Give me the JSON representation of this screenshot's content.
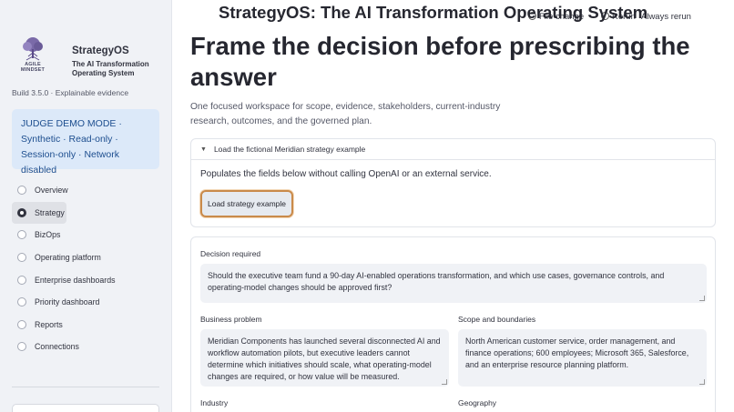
{
  "overlay_title": "StrategyOS: The AI Transformation Operating System",
  "toolbar": {
    "items": [
      "File change",
      "Rerun",
      "Always rerun"
    ]
  },
  "sidebar": {
    "logo_text_line1": "AGILE",
    "logo_text_line2": "MINDSET",
    "brand_name": "StrategyOS",
    "brand_sub": "The AI Transformation Operating System",
    "build": "Build 3.5.0 · Explainable evidence",
    "demo_notice": "JUDGE DEMO MODE · Synthetic · Read-only · Session-only · Network disabled",
    "nav": [
      {
        "label": "Overview",
        "active": false
      },
      {
        "label": "Strategy",
        "active": true
      },
      {
        "label": "BizOps",
        "active": false
      },
      {
        "label": "Operating platform",
        "active": false
      },
      {
        "label": "Enterprise dashboards",
        "active": false
      },
      {
        "label": "Priority dashboard",
        "active": false
      },
      {
        "label": "Reports",
        "active": false
      },
      {
        "label": "Connections",
        "active": false
      }
    ]
  },
  "main": {
    "heading": "Frame the decision before prescribing the answer",
    "lead": "One focused workspace for scope, evidence, stakeholders, current-industry research, outcomes, and the governed plan.",
    "expander": {
      "title": "Load the fictional Meridian strategy example",
      "description": "Populates the fields below without calling OpenAI or an external service.",
      "button": "Load strategy example"
    },
    "form": {
      "decision_label": "Decision required",
      "decision_value": "Should the executive team fund a 90-day AI-enabled operations transformation, and which use cases, governance controls, and operating-model changes should be approved first?",
      "problem_label": "Business problem",
      "problem_value": "Meridian Components has launched several disconnected AI and workflow automation pilots, but executive leaders cannot determine which initiatives should scale, what operating-model changes are required, or how value will be measured.",
      "scope_label": "Scope and boundaries",
      "scope_value": "North American customer service, order management, and finance operations; 600 employees; Microsoft 365, Salesforce, and an enterprise resource planning platform.",
      "industry_label": "Industry",
      "geography_label": "Geography"
    }
  }
}
